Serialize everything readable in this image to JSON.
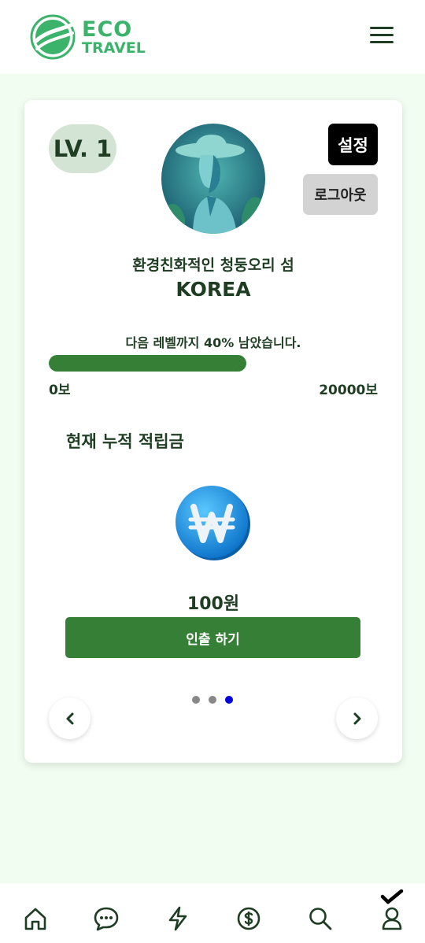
{
  "header": {
    "logo_line1": "ECO",
    "logo_line2": "TRAVEL",
    "brand_color": "#3bb36a",
    "menu_icon": "hamburger-menu-icon"
  },
  "profile": {
    "level": "LV. 1",
    "settings_label": "설정",
    "logout_label": "로그아웃",
    "nickname": "환경친화적인 청둥오리 섬",
    "country": "KOREA",
    "avatar_icon": "woman-in-hat-avatar"
  },
  "progress": {
    "text": "다음 레벨까지 40% 남았습니다.",
    "fraction": 0.6,
    "min_label": "0보",
    "max_label": "20000보",
    "fill_color": "#357f37"
  },
  "savings": {
    "title": "현재 누적 적립금",
    "coin_icon": "won-coin-icon",
    "amount": "100원",
    "withdraw_label": "인출 하기"
  },
  "carousel": {
    "dot_count": 3,
    "active_index": 2,
    "prev_icon": "chevron-left-icon",
    "next_icon": "chevron-right-icon"
  },
  "bottom_nav": {
    "items": [
      "home-icon",
      "chat-icon",
      "lightning-icon",
      "dollar-icon",
      "search-icon",
      "user-icon"
    ],
    "active_index": 5,
    "active_marker": "check-icon"
  },
  "colors": {
    "page_bg": "#f1fdf0",
    "primary_green": "#357f37",
    "text_dark": "#1e3d22",
    "active_dot": "#0000dd"
  }
}
